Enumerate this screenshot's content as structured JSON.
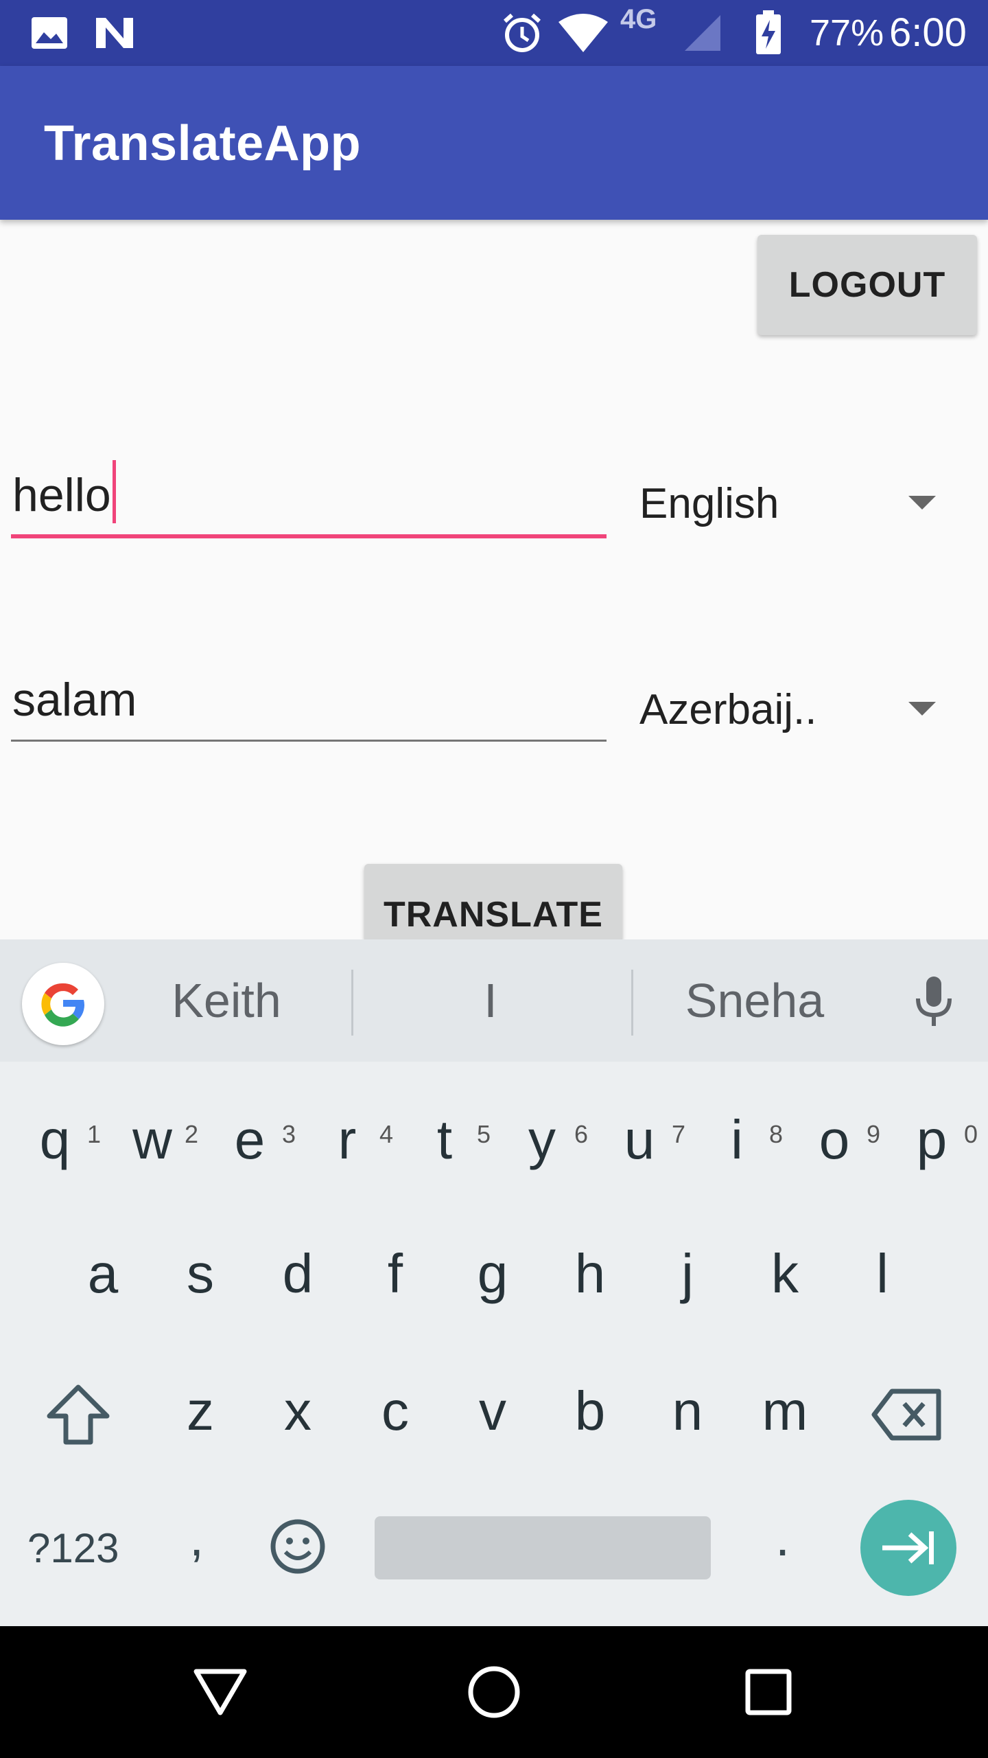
{
  "status_bar": {
    "battery_percent": "77%",
    "time": "6:00",
    "network_label": "4G",
    "icons": [
      "image-icon",
      "n-logo-icon",
      "alarm-icon",
      "wifi-icon",
      "signal-icon",
      "battery-charging-icon"
    ],
    "background": "#303f9f"
  },
  "app_bar": {
    "title": "TranslateApp",
    "background": "#3f51b5"
  },
  "logout_button": {
    "label": "LOGOUT"
  },
  "source": {
    "text": "hello",
    "language": "English",
    "underline_color": "#f0447a"
  },
  "target": {
    "text": "salam",
    "language": "Azerbaij.."
  },
  "translate_button": {
    "label": "TRANSLATE"
  },
  "keyboard": {
    "suggestions": [
      "Keith",
      "I",
      "Sneha"
    ],
    "row1": [
      {
        "key": "q",
        "hint": "1"
      },
      {
        "key": "w",
        "hint": "2"
      },
      {
        "key": "e",
        "hint": "3"
      },
      {
        "key": "r",
        "hint": "4"
      },
      {
        "key": "t",
        "hint": "5"
      },
      {
        "key": "y",
        "hint": "6"
      },
      {
        "key": "u",
        "hint": "7"
      },
      {
        "key": "i",
        "hint": "8"
      },
      {
        "key": "o",
        "hint": "9"
      },
      {
        "key": "p",
        "hint": "0"
      }
    ],
    "row2": [
      "a",
      "s",
      "d",
      "f",
      "g",
      "h",
      "j",
      "k",
      "l"
    ],
    "row3": [
      "z",
      "x",
      "c",
      "v",
      "b",
      "n",
      "m"
    ],
    "symbols_label": "?123",
    "comma": ",",
    "period": ".",
    "enter_color": "#4db6ac"
  },
  "nav_bar": {
    "icons": [
      "back-icon",
      "home-icon",
      "recents-icon"
    ]
  }
}
